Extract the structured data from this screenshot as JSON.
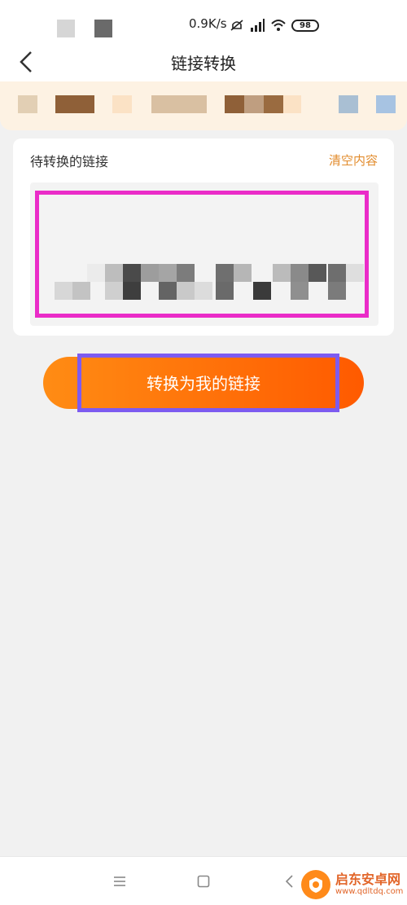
{
  "status_bar": {
    "network_speed": "0.9K/s",
    "battery": "98"
  },
  "nav": {
    "title": "链接转换"
  },
  "card": {
    "label": "待转换的链接",
    "clear_label": "清空内容"
  },
  "convert_button": {
    "label": "转换为我的链接"
  },
  "watermark": {
    "name": "启东安卓网",
    "url": "www.qdltdq.com"
  },
  "colors": {
    "accent": "#ff6a00",
    "link": "#e28c2d",
    "highlight_pink": "#ea2cc8",
    "highlight_purple": "#7d5bf0"
  },
  "icons": {
    "back": "chevron-left-icon",
    "menu": "menu-icon",
    "home": "square-icon",
    "sys_back": "chevron-left-icon"
  }
}
